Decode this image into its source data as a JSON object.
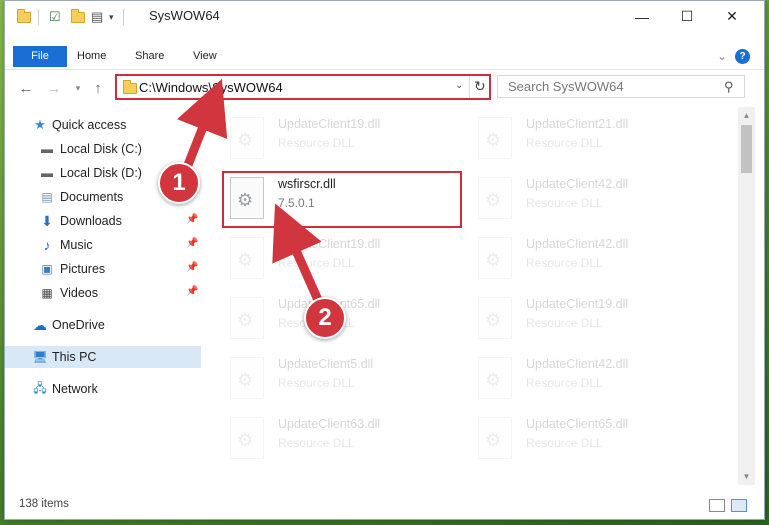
{
  "window": {
    "title": "SysWOW64",
    "controls": {
      "minimize": "—",
      "maximize": "☐",
      "close": "✕"
    }
  },
  "ribbon": {
    "tabs": [
      "File",
      "Home",
      "Share",
      "View"
    ],
    "expand_icon": "chevron-down-icon",
    "help_icon": "?"
  },
  "navigation": {
    "address": "C:\\Windows\\SysWOW64",
    "search_placeholder": "Search SysWOW64"
  },
  "sidebar": {
    "items": [
      {
        "label": "Quick access",
        "icon": "star-icon",
        "level": "top"
      },
      {
        "label": "Local Disk (C:)",
        "icon": "drive-icon",
        "level": "child"
      },
      {
        "label": "Local Disk (D:)",
        "icon": "drive-icon",
        "level": "child"
      },
      {
        "label": "Documents",
        "icon": "documents-icon",
        "level": "child",
        "pinned": true
      },
      {
        "label": "Downloads",
        "icon": "download-icon",
        "level": "child",
        "pinned": true
      },
      {
        "label": "Music",
        "icon": "music-icon",
        "level": "child",
        "pinned": true
      },
      {
        "label": "Pictures",
        "icon": "pictures-icon",
        "level": "child",
        "pinned": true
      },
      {
        "label": "Videos",
        "icon": "videos-icon",
        "level": "child",
        "pinned": true
      },
      {
        "label": "OneDrive",
        "icon": "cloud-icon",
        "level": "top"
      },
      {
        "label": "This PC",
        "icon": "computer-icon",
        "level": "top",
        "selected": true
      },
      {
        "label": "Network",
        "icon": "network-icon",
        "level": "top"
      }
    ]
  },
  "files": {
    "left_column": [
      {
        "name": "UpdateClient19.dll",
        "desc": "Resource DLL",
        "faded": true
      },
      {
        "name": "wsfirscr.dll",
        "desc": "7.5.0.1",
        "faded": false,
        "highlighted": true
      },
      {
        "name": "UpdateClient19.dll",
        "desc": "Resource DLL",
        "faded": true
      },
      {
        "name": "UpdateClient65.dll",
        "desc": "Resource DLL",
        "faded": true
      },
      {
        "name": "UpdateClient5.dll",
        "desc": "Resource DLL",
        "faded": true
      },
      {
        "name": "UpdateClient63.dll",
        "desc": "Resource DLL",
        "faded": true
      }
    ],
    "right_column": [
      {
        "name": "UpdateClient21.dll",
        "desc": "Resource DLL",
        "faded": true
      },
      {
        "name": "UpdateClient42.dll",
        "desc": "Resource DLL",
        "faded": true
      },
      {
        "name": "UpdateClient42.dll",
        "desc": "Resource DLL",
        "faded": true
      },
      {
        "name": "UpdateClient19.dll",
        "desc": "Resource DLL",
        "faded": true
      },
      {
        "name": "UpdateClient42.dll",
        "desc": "Resource DLL",
        "faded": true
      },
      {
        "name": "UpdateClient65.dll",
        "desc": "Resource DLL",
        "faded": true
      }
    ]
  },
  "status": {
    "item_count": "138 items"
  },
  "annotations": {
    "callouts": [
      "1",
      "2"
    ],
    "accent_color": "#c9303a"
  }
}
